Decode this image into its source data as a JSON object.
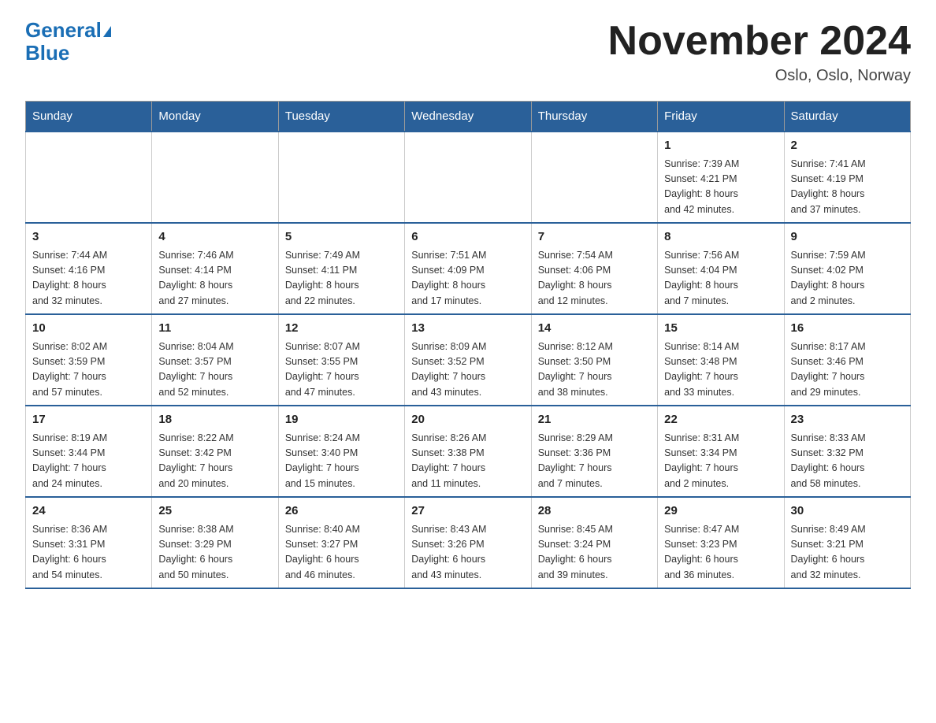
{
  "logo": {
    "text_general": "General",
    "text_blue": "Blue"
  },
  "header": {
    "month_year": "November 2024",
    "location": "Oslo, Oslo, Norway"
  },
  "weekdays": [
    "Sunday",
    "Monday",
    "Tuesday",
    "Wednesday",
    "Thursday",
    "Friday",
    "Saturday"
  ],
  "weeks": [
    [
      {
        "day": "",
        "info": ""
      },
      {
        "day": "",
        "info": ""
      },
      {
        "day": "",
        "info": ""
      },
      {
        "day": "",
        "info": ""
      },
      {
        "day": "",
        "info": ""
      },
      {
        "day": "1",
        "info": "Sunrise: 7:39 AM\nSunset: 4:21 PM\nDaylight: 8 hours\nand 42 minutes."
      },
      {
        "day": "2",
        "info": "Sunrise: 7:41 AM\nSunset: 4:19 PM\nDaylight: 8 hours\nand 37 minutes."
      }
    ],
    [
      {
        "day": "3",
        "info": "Sunrise: 7:44 AM\nSunset: 4:16 PM\nDaylight: 8 hours\nand 32 minutes."
      },
      {
        "day": "4",
        "info": "Sunrise: 7:46 AM\nSunset: 4:14 PM\nDaylight: 8 hours\nand 27 minutes."
      },
      {
        "day": "5",
        "info": "Sunrise: 7:49 AM\nSunset: 4:11 PM\nDaylight: 8 hours\nand 22 minutes."
      },
      {
        "day": "6",
        "info": "Sunrise: 7:51 AM\nSunset: 4:09 PM\nDaylight: 8 hours\nand 17 minutes."
      },
      {
        "day": "7",
        "info": "Sunrise: 7:54 AM\nSunset: 4:06 PM\nDaylight: 8 hours\nand 12 minutes."
      },
      {
        "day": "8",
        "info": "Sunrise: 7:56 AM\nSunset: 4:04 PM\nDaylight: 8 hours\nand 7 minutes."
      },
      {
        "day": "9",
        "info": "Sunrise: 7:59 AM\nSunset: 4:02 PM\nDaylight: 8 hours\nand 2 minutes."
      }
    ],
    [
      {
        "day": "10",
        "info": "Sunrise: 8:02 AM\nSunset: 3:59 PM\nDaylight: 7 hours\nand 57 minutes."
      },
      {
        "day": "11",
        "info": "Sunrise: 8:04 AM\nSunset: 3:57 PM\nDaylight: 7 hours\nand 52 minutes."
      },
      {
        "day": "12",
        "info": "Sunrise: 8:07 AM\nSunset: 3:55 PM\nDaylight: 7 hours\nand 47 minutes."
      },
      {
        "day": "13",
        "info": "Sunrise: 8:09 AM\nSunset: 3:52 PM\nDaylight: 7 hours\nand 43 minutes."
      },
      {
        "day": "14",
        "info": "Sunrise: 8:12 AM\nSunset: 3:50 PM\nDaylight: 7 hours\nand 38 minutes."
      },
      {
        "day": "15",
        "info": "Sunrise: 8:14 AM\nSunset: 3:48 PM\nDaylight: 7 hours\nand 33 minutes."
      },
      {
        "day": "16",
        "info": "Sunrise: 8:17 AM\nSunset: 3:46 PM\nDaylight: 7 hours\nand 29 minutes."
      }
    ],
    [
      {
        "day": "17",
        "info": "Sunrise: 8:19 AM\nSunset: 3:44 PM\nDaylight: 7 hours\nand 24 minutes."
      },
      {
        "day": "18",
        "info": "Sunrise: 8:22 AM\nSunset: 3:42 PM\nDaylight: 7 hours\nand 20 minutes."
      },
      {
        "day": "19",
        "info": "Sunrise: 8:24 AM\nSunset: 3:40 PM\nDaylight: 7 hours\nand 15 minutes."
      },
      {
        "day": "20",
        "info": "Sunrise: 8:26 AM\nSunset: 3:38 PM\nDaylight: 7 hours\nand 11 minutes."
      },
      {
        "day": "21",
        "info": "Sunrise: 8:29 AM\nSunset: 3:36 PM\nDaylight: 7 hours\nand 7 minutes."
      },
      {
        "day": "22",
        "info": "Sunrise: 8:31 AM\nSunset: 3:34 PM\nDaylight: 7 hours\nand 2 minutes."
      },
      {
        "day": "23",
        "info": "Sunrise: 8:33 AM\nSunset: 3:32 PM\nDaylight: 6 hours\nand 58 minutes."
      }
    ],
    [
      {
        "day": "24",
        "info": "Sunrise: 8:36 AM\nSunset: 3:31 PM\nDaylight: 6 hours\nand 54 minutes."
      },
      {
        "day": "25",
        "info": "Sunrise: 8:38 AM\nSunset: 3:29 PM\nDaylight: 6 hours\nand 50 minutes."
      },
      {
        "day": "26",
        "info": "Sunrise: 8:40 AM\nSunset: 3:27 PM\nDaylight: 6 hours\nand 46 minutes."
      },
      {
        "day": "27",
        "info": "Sunrise: 8:43 AM\nSunset: 3:26 PM\nDaylight: 6 hours\nand 43 minutes."
      },
      {
        "day": "28",
        "info": "Sunrise: 8:45 AM\nSunset: 3:24 PM\nDaylight: 6 hours\nand 39 minutes."
      },
      {
        "day": "29",
        "info": "Sunrise: 8:47 AM\nSunset: 3:23 PM\nDaylight: 6 hours\nand 36 minutes."
      },
      {
        "day": "30",
        "info": "Sunrise: 8:49 AM\nSunset: 3:21 PM\nDaylight: 6 hours\nand 32 minutes."
      }
    ]
  ]
}
